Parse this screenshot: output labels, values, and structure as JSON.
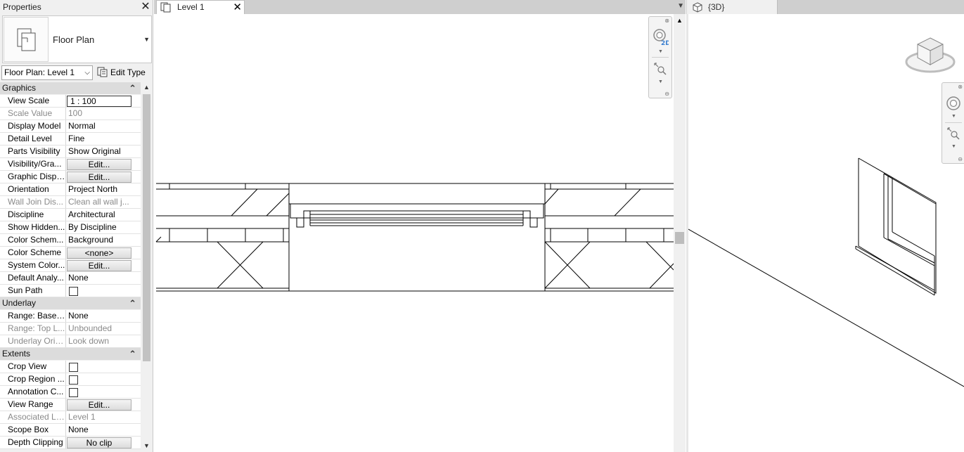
{
  "properties_panel": {
    "title": "Properties",
    "type_name": "Floor Plan",
    "instance_selector": "Floor Plan: Level 1",
    "edit_type_label": "Edit Type",
    "sections": [
      {
        "name": "Graphics",
        "rows": [
          {
            "label": "View Scale",
            "value": "1 : 100",
            "kind": "input"
          },
          {
            "label": "Scale Value",
            "value": "100",
            "kind": "text",
            "disabled": true
          },
          {
            "label": "Display Model",
            "value": "Normal",
            "kind": "text"
          },
          {
            "label": "Detail Level",
            "value": "Fine",
            "kind": "text"
          },
          {
            "label": "Parts Visibility",
            "value": "Show Original",
            "kind": "text"
          },
          {
            "label": "Visibility/Gra...",
            "value": "Edit...",
            "kind": "button"
          },
          {
            "label": "Graphic Displ...",
            "value": "Edit...",
            "kind": "button"
          },
          {
            "label": "Orientation",
            "value": "Project North",
            "kind": "text"
          },
          {
            "label": "Wall Join Dis...",
            "value": "Clean all wall j...",
            "kind": "text",
            "disabled": true
          },
          {
            "label": "Discipline",
            "value": "Architectural",
            "kind": "text"
          },
          {
            "label": "Show Hidden...",
            "value": "By Discipline",
            "kind": "text"
          },
          {
            "label": "Color Schem...",
            "value": "Background",
            "kind": "text"
          },
          {
            "label": "Color Scheme",
            "value": "<none>",
            "kind": "button"
          },
          {
            "label": "System Color...",
            "value": "Edit...",
            "kind": "button"
          },
          {
            "label": "Default Analy...",
            "value": "None",
            "kind": "text"
          },
          {
            "label": "Sun Path",
            "value": "",
            "kind": "checkbox"
          }
        ]
      },
      {
        "name": "Underlay",
        "rows": [
          {
            "label": "Range: Base ...",
            "value": "None",
            "kind": "text"
          },
          {
            "label": "Range: Top L...",
            "value": "Unbounded",
            "kind": "text",
            "disabled": true
          },
          {
            "label": "Underlay Orie...",
            "value": "Look down",
            "kind": "text",
            "disabled": true
          }
        ]
      },
      {
        "name": "Extents",
        "rows": [
          {
            "label": "Crop View",
            "value": "",
            "kind": "checkbox"
          },
          {
            "label": "Crop Region ...",
            "value": "",
            "kind": "checkbox"
          },
          {
            "label": "Annotation C...",
            "value": "",
            "kind": "checkbox"
          },
          {
            "label": "View Range",
            "value": "Edit...",
            "kind": "button"
          },
          {
            "label": "Associated Le...",
            "value": "Level 1",
            "kind": "text",
            "disabled": true
          },
          {
            "label": "Scope Box",
            "value": "None",
            "kind": "text"
          },
          {
            "label": "Depth Clipping",
            "value": "No clip",
            "kind": "button"
          }
        ]
      }
    ]
  },
  "views": {
    "plan_tab_label": "Level 1",
    "threed_tab_label": "{3D}"
  },
  "icons": {
    "properties_close": "close-icon",
    "plan_tab_close": "close-icon",
    "section_collapse": "double-chevron-up-icon",
    "view_cube": "view-cube-icon",
    "steering_wheel": "steering-wheel-icon",
    "zoom": "zoom-region-icon"
  },
  "colors": {
    "panel_bg": "#f0f0f0",
    "section_header_bg": "#dcdcdc",
    "tab_bar_bg": "#cfcfcf",
    "disabled_text": "#8a8a8a"
  }
}
